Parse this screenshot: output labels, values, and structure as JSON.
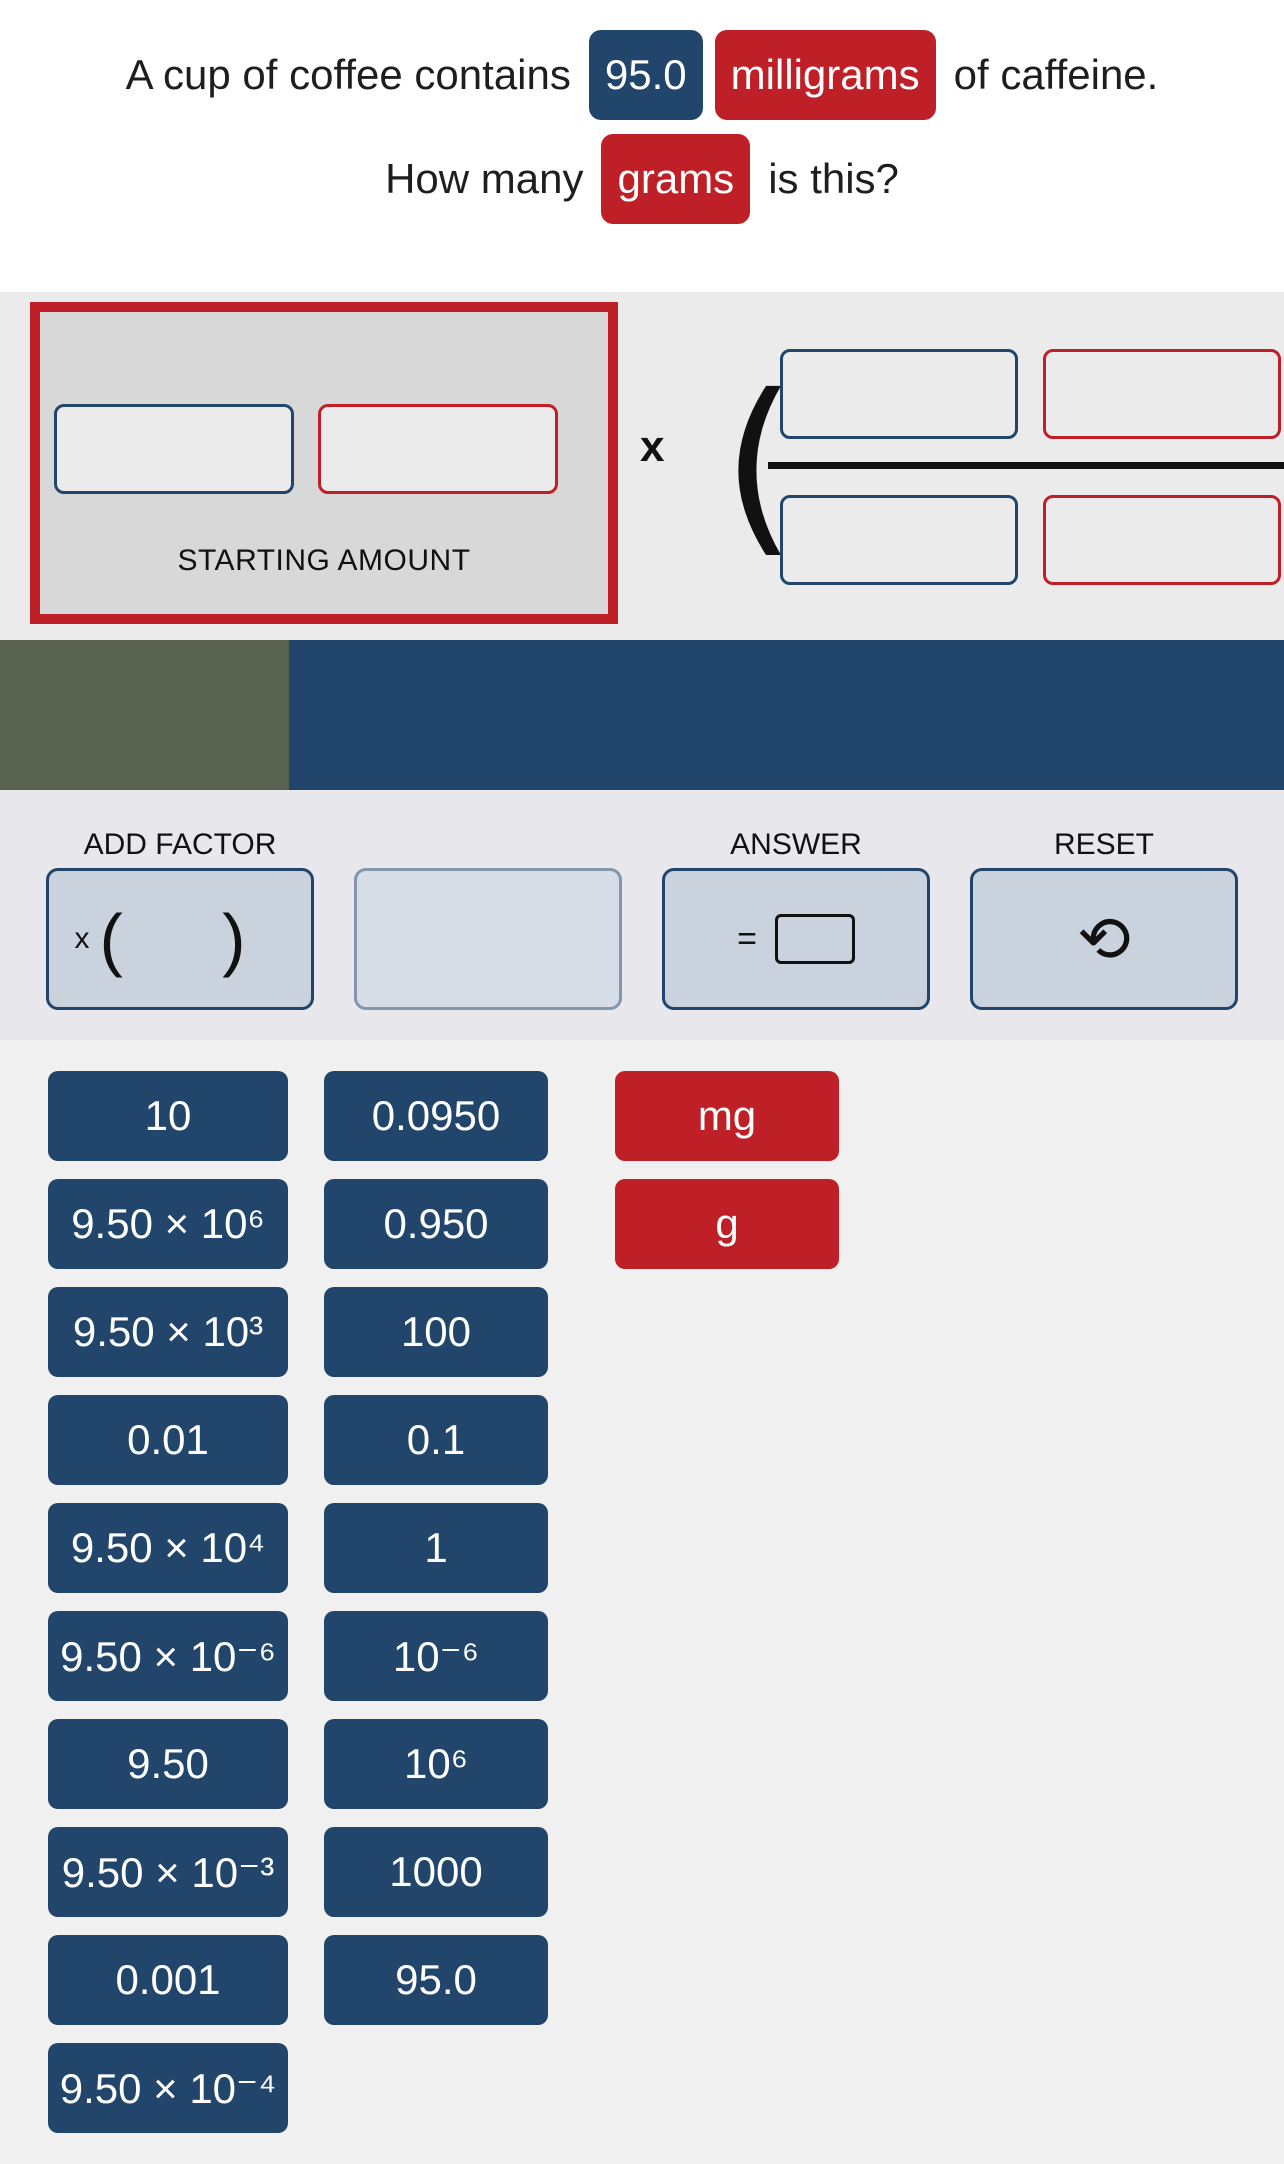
{
  "question": {
    "line1_prefix": "A cup of coffee contains",
    "amount": "95.0",
    "unit": "milligrams",
    "line1_suffix": "of caffeine.",
    "line2_prefix": "How many",
    "target_unit": "grams",
    "line2_suffix": "is this?"
  },
  "workspace": {
    "starting_amount_label": "STARTING AMOUNT",
    "multiply_symbol": "x",
    "open_paren": "("
  },
  "controls": {
    "add_factor_label": "ADD FACTOR",
    "add_factor_x": "x",
    "add_factor_parens": "( )",
    "answer_label": "ANSWER",
    "answer_equals": "=",
    "reset_label": "RESET",
    "reset_glyph": "⟲"
  },
  "tiles": {
    "col1": [
      "10",
      "9.50 × 10⁶",
      "9.50 × 10³",
      "0.01",
      "9.50 × 10⁴",
      "9.50 × 10⁻⁶",
      "9.50",
      "9.50 × 10⁻³",
      "0.001",
      "9.50 × 10⁻⁴"
    ],
    "col2": [
      "0.0950",
      "0.950",
      "100",
      "0.1",
      "1",
      "10⁻⁶",
      "10⁶",
      "1000",
      "95.0"
    ],
    "units": [
      "mg",
      "g"
    ]
  },
  "colors": {
    "blue": "#22466b",
    "red": "#bf1f26",
    "olive": "#5a6350"
  },
  "icons": {
    "reset": "undo-arrow-icon"
  }
}
